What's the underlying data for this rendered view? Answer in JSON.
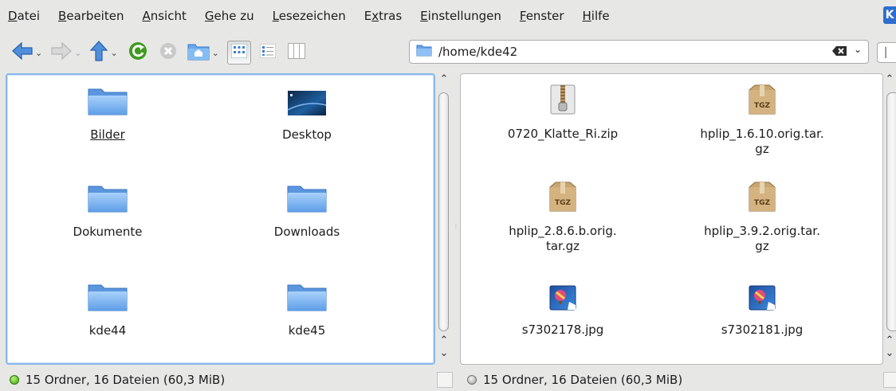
{
  "menubar": {
    "items": [
      {
        "u": "D",
        "rest": "atei"
      },
      {
        "u": "B",
        "rest": "earbeiten"
      },
      {
        "u": "A",
        "rest": "nsicht"
      },
      {
        "u": "G",
        "rest": "ehe zu"
      },
      {
        "u": "L",
        "rest": "esezeichen"
      },
      {
        "pre": "E",
        "u": "x",
        "rest": "tras"
      },
      {
        "u": "E",
        "rest": "instellungen"
      },
      {
        "u": "F",
        "rest": "enster"
      },
      {
        "u": "H",
        "rest": "ilfe"
      }
    ]
  },
  "location": {
    "path": "/home/kde42"
  },
  "left_pane": {
    "items": [
      {
        "label": "Bilder",
        "icon": "folder-icon"
      },
      {
        "label": "Desktop",
        "icon": "desktop-icon"
      },
      {
        "label": "Dokumente",
        "icon": "folder-icon"
      },
      {
        "label": "Downloads",
        "icon": "folder-icon"
      },
      {
        "label": "kde44",
        "icon": "folder-icon"
      },
      {
        "label": "kde45",
        "icon": "folder-icon"
      }
    ],
    "status": "15 Ordner, 16 Dateien (60,3 MiB)"
  },
  "right_pane": {
    "items": [
      {
        "label": "0720_Klatte_Ri.zip",
        "icon": "zip-archive-icon"
      },
      {
        "label": "hplip_1.6.10.orig.tar.\ngz",
        "icon": "tgz-archive-icon"
      },
      {
        "label": "hplip_2.8.6.b.orig.\ntar.gz",
        "icon": "tgz-archive-icon"
      },
      {
        "label": "hplip_3.9.2.orig.tar.\ngz",
        "icon": "tgz-archive-icon"
      },
      {
        "label": "s7302178.jpg",
        "icon": "image-icon"
      },
      {
        "label": "s7302181.jpg",
        "icon": "image-icon"
      }
    ],
    "status": "15 Ordner, 16 Dateien (60,3 MiB)"
  },
  "colors": {
    "active_pane_border": "#87b8ec",
    "folder_blue": "#6aa4e8"
  }
}
